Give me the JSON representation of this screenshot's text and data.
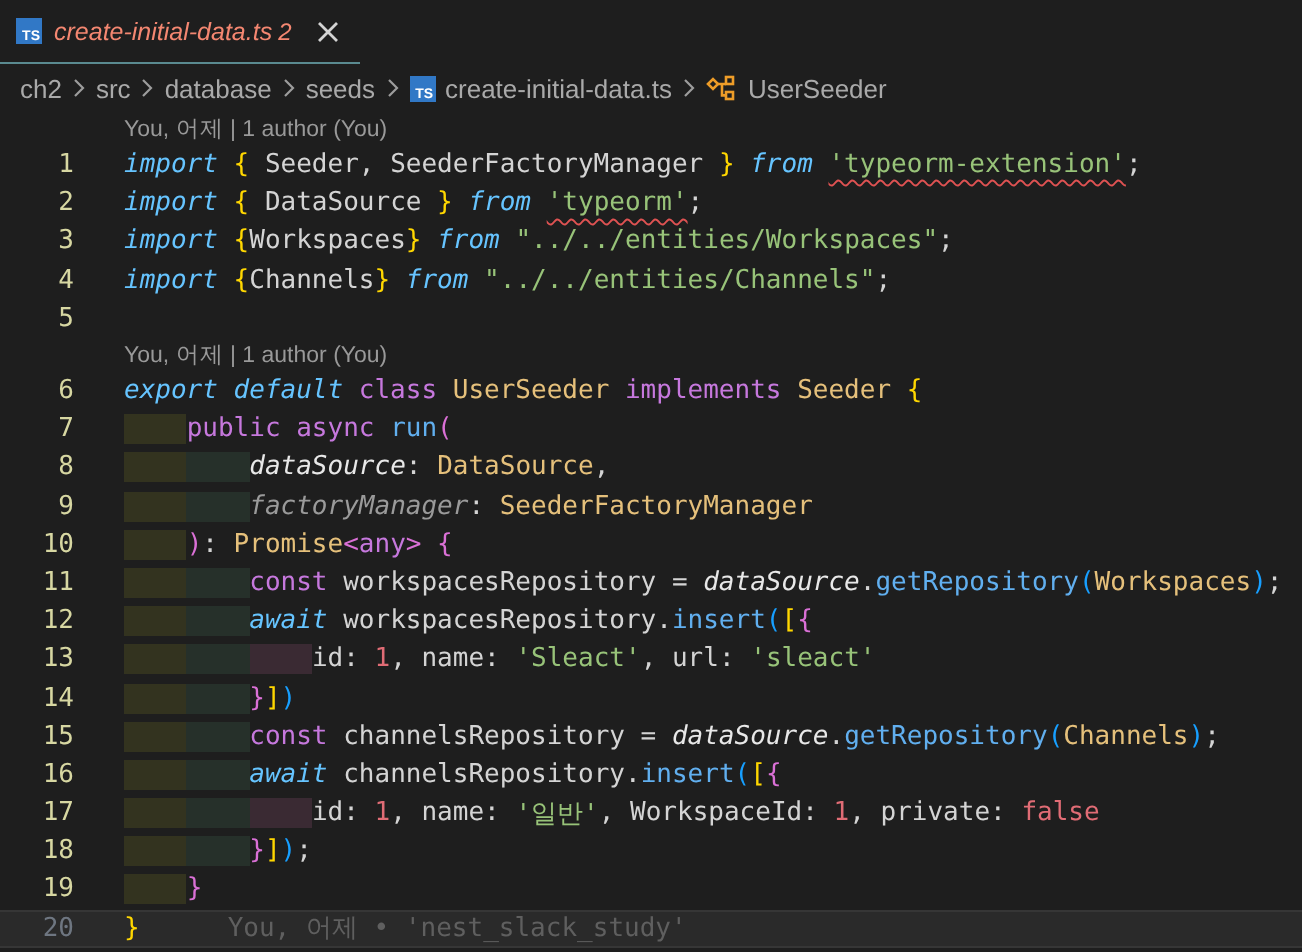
{
  "tab": {
    "icon_text": "TS",
    "title": "create-initial-data.ts",
    "problems": "2",
    "selected": true
  },
  "breadcrumb": [
    {
      "kind": "folder",
      "label": "ch2"
    },
    {
      "kind": "folder",
      "label": "src"
    },
    {
      "kind": "folder",
      "label": "database"
    },
    {
      "kind": "folder",
      "label": "seeds"
    },
    {
      "kind": "file",
      "icon_text": "TS",
      "label": "create-initial-data.ts"
    },
    {
      "kind": "class",
      "label": "UserSeeder"
    }
  ],
  "lines": [
    {
      "number": "1",
      "changed": true,
      "current": false,
      "codelens": "You, 어제 | 1 author (You)",
      "tokens": [
        {
          "text": "import ",
          "kind": "keyword"
        },
        {
          "text": "{",
          "kind": "bracket1"
        },
        {
          "text": " Seeder, SeederFactoryManager ",
          "kind": "plain"
        },
        {
          "text": "} ",
          "kind": "bracket1"
        },
        {
          "text": "from ",
          "kind": "keyword"
        },
        {
          "text": "'typeorm-extension'",
          "kind": "string",
          "error": true
        },
        {
          "text": ";",
          "kind": "plain"
        }
      ]
    },
    {
      "number": "2",
      "changed": true,
      "current": false,
      "tokens": [
        {
          "text": "import ",
          "kind": "keyword"
        },
        {
          "text": "{",
          "kind": "bracket1"
        },
        {
          "text": " DataSource ",
          "kind": "plain"
        },
        {
          "text": "} ",
          "kind": "bracket1"
        },
        {
          "text": "from ",
          "kind": "keyword"
        },
        {
          "text": "'typeorm'",
          "kind": "string",
          "error": true
        },
        {
          "text": ";",
          "kind": "plain"
        }
      ]
    },
    {
      "number": "3",
      "changed": true,
      "current": false,
      "tokens": [
        {
          "text": "import ",
          "kind": "keyword"
        },
        {
          "text": "{",
          "kind": "bracket1"
        },
        {
          "text": "Workspaces",
          "kind": "plain"
        },
        {
          "text": "} ",
          "kind": "bracket1"
        },
        {
          "text": "from ",
          "kind": "keyword"
        },
        {
          "text": "\"../../entities/Workspaces\"",
          "kind": "string"
        },
        {
          "text": ";",
          "kind": "plain"
        }
      ]
    },
    {
      "number": "4",
      "changed": true,
      "current": false,
      "tokens": [
        {
          "text": "import ",
          "kind": "keyword"
        },
        {
          "text": "{",
          "kind": "bracket1"
        },
        {
          "text": "Channels",
          "kind": "plain"
        },
        {
          "text": "} ",
          "kind": "bracket1"
        },
        {
          "text": "from ",
          "kind": "keyword"
        },
        {
          "text": "\"../../entities/Channels\"",
          "kind": "string"
        },
        {
          "text": ";",
          "kind": "plain"
        }
      ]
    },
    {
      "number": "5",
      "changed": true,
      "current": false
    },
    {
      "number": "6",
      "changed": true,
      "current": false,
      "codelens": "You, 어제 | 1 author (You)",
      "tokens": [
        {
          "text": "export default ",
          "kind": "keyword"
        },
        {
          "text": "class ",
          "kind": "storage"
        },
        {
          "text": "UserSeeder ",
          "kind": "type"
        },
        {
          "text": "implements ",
          "kind": "storage"
        },
        {
          "text": "Seeder ",
          "kind": "type"
        },
        {
          "text": "{",
          "kind": "bracket1"
        }
      ]
    },
    {
      "number": "7",
      "changed": true,
      "current": false,
      "tokens": [
        {
          "text": "    public async ",
          "kind": "storage"
        },
        {
          "text": "run",
          "kind": "function"
        },
        {
          "text": "(",
          "kind": "bracket2"
        }
      ]
    },
    {
      "number": "8",
      "changed": true,
      "current": false,
      "tokens": [
        {
          "text": "        dataSource",
          "kind": "parameter"
        },
        {
          "text": ": ",
          "kind": "plain"
        },
        {
          "text": "DataSource",
          "kind": "type"
        },
        {
          "text": ",",
          "kind": "plain"
        }
      ]
    },
    {
      "number": "9",
      "changed": true,
      "current": false,
      "tokens": [
        {
          "text": "        factoryManager",
          "kind": "unused"
        },
        {
          "text": ": ",
          "kind": "plain"
        },
        {
          "text": "SeederFactoryManager",
          "kind": "type"
        }
      ]
    },
    {
      "number": "10",
      "changed": true,
      "current": false,
      "tokens": [
        {
          "text": "    )",
          "kind": "bracket2"
        },
        {
          "text": ": ",
          "kind": "plain"
        },
        {
          "text": "Promise",
          "kind": "type"
        },
        {
          "text": "<",
          "kind": "bracket2"
        },
        {
          "text": "any",
          "kind": "storage"
        },
        {
          "text": "> {",
          "kind": "bracket2"
        }
      ]
    },
    {
      "number": "11",
      "changed": true,
      "current": false,
      "tokens": [
        {
          "text": "        const",
          "kind": "storage"
        },
        {
          "text": " workspacesRepository = ",
          "kind": "plain"
        },
        {
          "text": "dataSource",
          "kind": "parameter"
        },
        {
          "text": ".",
          "kind": "plain"
        },
        {
          "text": "getRepository",
          "kind": "function"
        },
        {
          "text": "(",
          "kind": "bracket3"
        },
        {
          "text": "Workspaces",
          "kind": "type"
        },
        {
          "text": ")",
          "kind": "bracket3"
        },
        {
          "text": ";",
          "kind": "plain"
        }
      ]
    },
    {
      "number": "12",
      "changed": true,
      "current": false,
      "tokens": [
        {
          "text": "        await",
          "kind": "keyword"
        },
        {
          "text": " workspacesRepository.",
          "kind": "plain"
        },
        {
          "text": "insert",
          "kind": "function"
        },
        {
          "text": "(",
          "kind": "bracket3"
        },
        {
          "text": "[",
          "kind": "bracket1"
        },
        {
          "text": "{",
          "kind": "bracket2"
        }
      ]
    },
    {
      "number": "13",
      "changed": true,
      "current": false,
      "tokens": [
        {
          "text": "            id: ",
          "kind": "plain"
        },
        {
          "text": "1",
          "kind": "number"
        },
        {
          "text": ", name: ",
          "kind": "plain"
        },
        {
          "text": "'Sleact'",
          "kind": "string"
        },
        {
          "text": ", url: ",
          "kind": "plain"
        },
        {
          "text": "'sleact'",
          "kind": "string"
        }
      ]
    },
    {
      "number": "14",
      "changed": true,
      "current": false,
      "tokens": [
        {
          "text": "        }",
          "kind": "bracket2"
        },
        {
          "text": "]",
          "kind": "bracket1"
        },
        {
          "text": ")",
          "kind": "bracket3"
        }
      ]
    },
    {
      "number": "15",
      "changed": true,
      "current": false,
      "tokens": [
        {
          "text": "        const",
          "kind": "storage"
        },
        {
          "text": " channelsRepository = ",
          "kind": "plain"
        },
        {
          "text": "dataSource",
          "kind": "parameter"
        },
        {
          "text": ".",
          "kind": "plain"
        },
        {
          "text": "getRepository",
          "kind": "function"
        },
        {
          "text": "(",
          "kind": "bracket3"
        },
        {
          "text": "Channels",
          "kind": "type"
        },
        {
          "text": ")",
          "kind": "bracket3"
        },
        {
          "text": ";",
          "kind": "plain"
        }
      ]
    },
    {
      "number": "16",
      "changed": true,
      "current": false,
      "tokens": [
        {
          "text": "        await",
          "kind": "keyword"
        },
        {
          "text": " channelsRepository.",
          "kind": "plain"
        },
        {
          "text": "insert",
          "kind": "function"
        },
        {
          "text": "(",
          "kind": "bracket3"
        },
        {
          "text": "[",
          "kind": "bracket1"
        },
        {
          "text": "{",
          "kind": "bracket2"
        }
      ]
    },
    {
      "number": "17",
      "changed": true,
      "current": false,
      "tokens": [
        {
          "text": "            id: ",
          "kind": "plain"
        },
        {
          "text": "1",
          "kind": "number"
        },
        {
          "text": ", name: ",
          "kind": "plain"
        },
        {
          "text": "'일반'",
          "kind": "string"
        },
        {
          "text": ", WorkspaceId: ",
          "kind": "plain"
        },
        {
          "text": "1",
          "kind": "number"
        },
        {
          "text": ", private: ",
          "kind": "plain"
        },
        {
          "text": "false",
          "kind": "number"
        }
      ]
    },
    {
      "number": "18",
      "changed": true,
      "current": false,
      "tokens": [
        {
          "text": "        }",
          "kind": "bracket2"
        },
        {
          "text": "]",
          "kind": "bracket1"
        },
        {
          "text": ")",
          "kind": "bracket3"
        },
        {
          "text": ";",
          "kind": "plain"
        }
      ]
    },
    {
      "number": "19",
      "changed": true,
      "current": false,
      "tokens": [
        {
          "text": "    }",
          "kind": "bracket2"
        }
      ]
    },
    {
      "number": "20",
      "changed": false,
      "current": true,
      "blame": "You, 어제 • 'nest_slack_study'",
      "tokens": [
        {
          "text": "}",
          "kind": "bracket1"
        }
      ]
    }
  ]
}
